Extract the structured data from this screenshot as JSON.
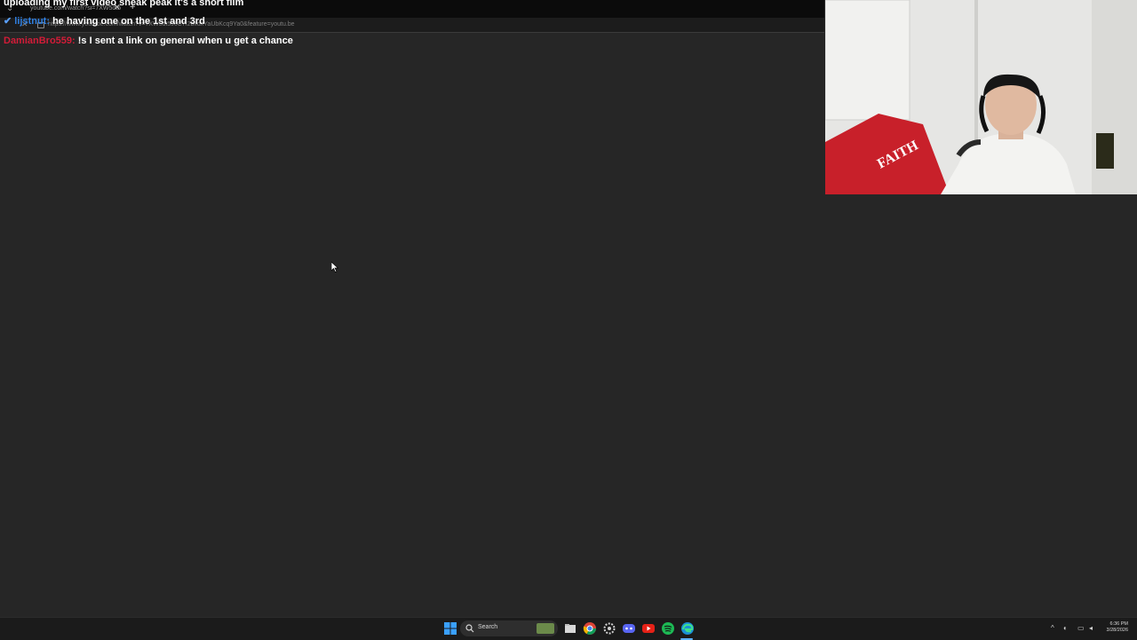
{
  "browser": {
    "tab_title": "youtube.com/watch?si=7XW5dt5",
    "url": "https://www.youtube.com/watch?v=7XW5dt5J6C7I2blfdxYaUbKcq9Ya0&feature=youtu.be"
  },
  "chat": {
    "messages": [
      {
        "user": "",
        "text": "uploading my first video sneak peak it's a short film"
      },
      {
        "user": "lijstnut:",
        "text": "he having one on the 1st and 3rd"
      },
      {
        "user": "DamianBro559:",
        "text": "!s I sent a link on general when u get a chance"
      }
    ]
  },
  "taskbar": {
    "search_placeholder": "Search",
    "time": "6:36 PM",
    "date": "3/28/2026",
    "icons": [
      "windows-start-icon",
      "search-icon",
      "file-explorer-icon",
      "chrome-icon",
      "settings-icon",
      "discord-icon",
      "youtube-icon",
      "spotify-icon",
      "edge-icon"
    ]
  },
  "colors": {
    "background": "#262626",
    "user_blue": "#2f7fe0",
    "user_red": "#d21c38"
  }
}
